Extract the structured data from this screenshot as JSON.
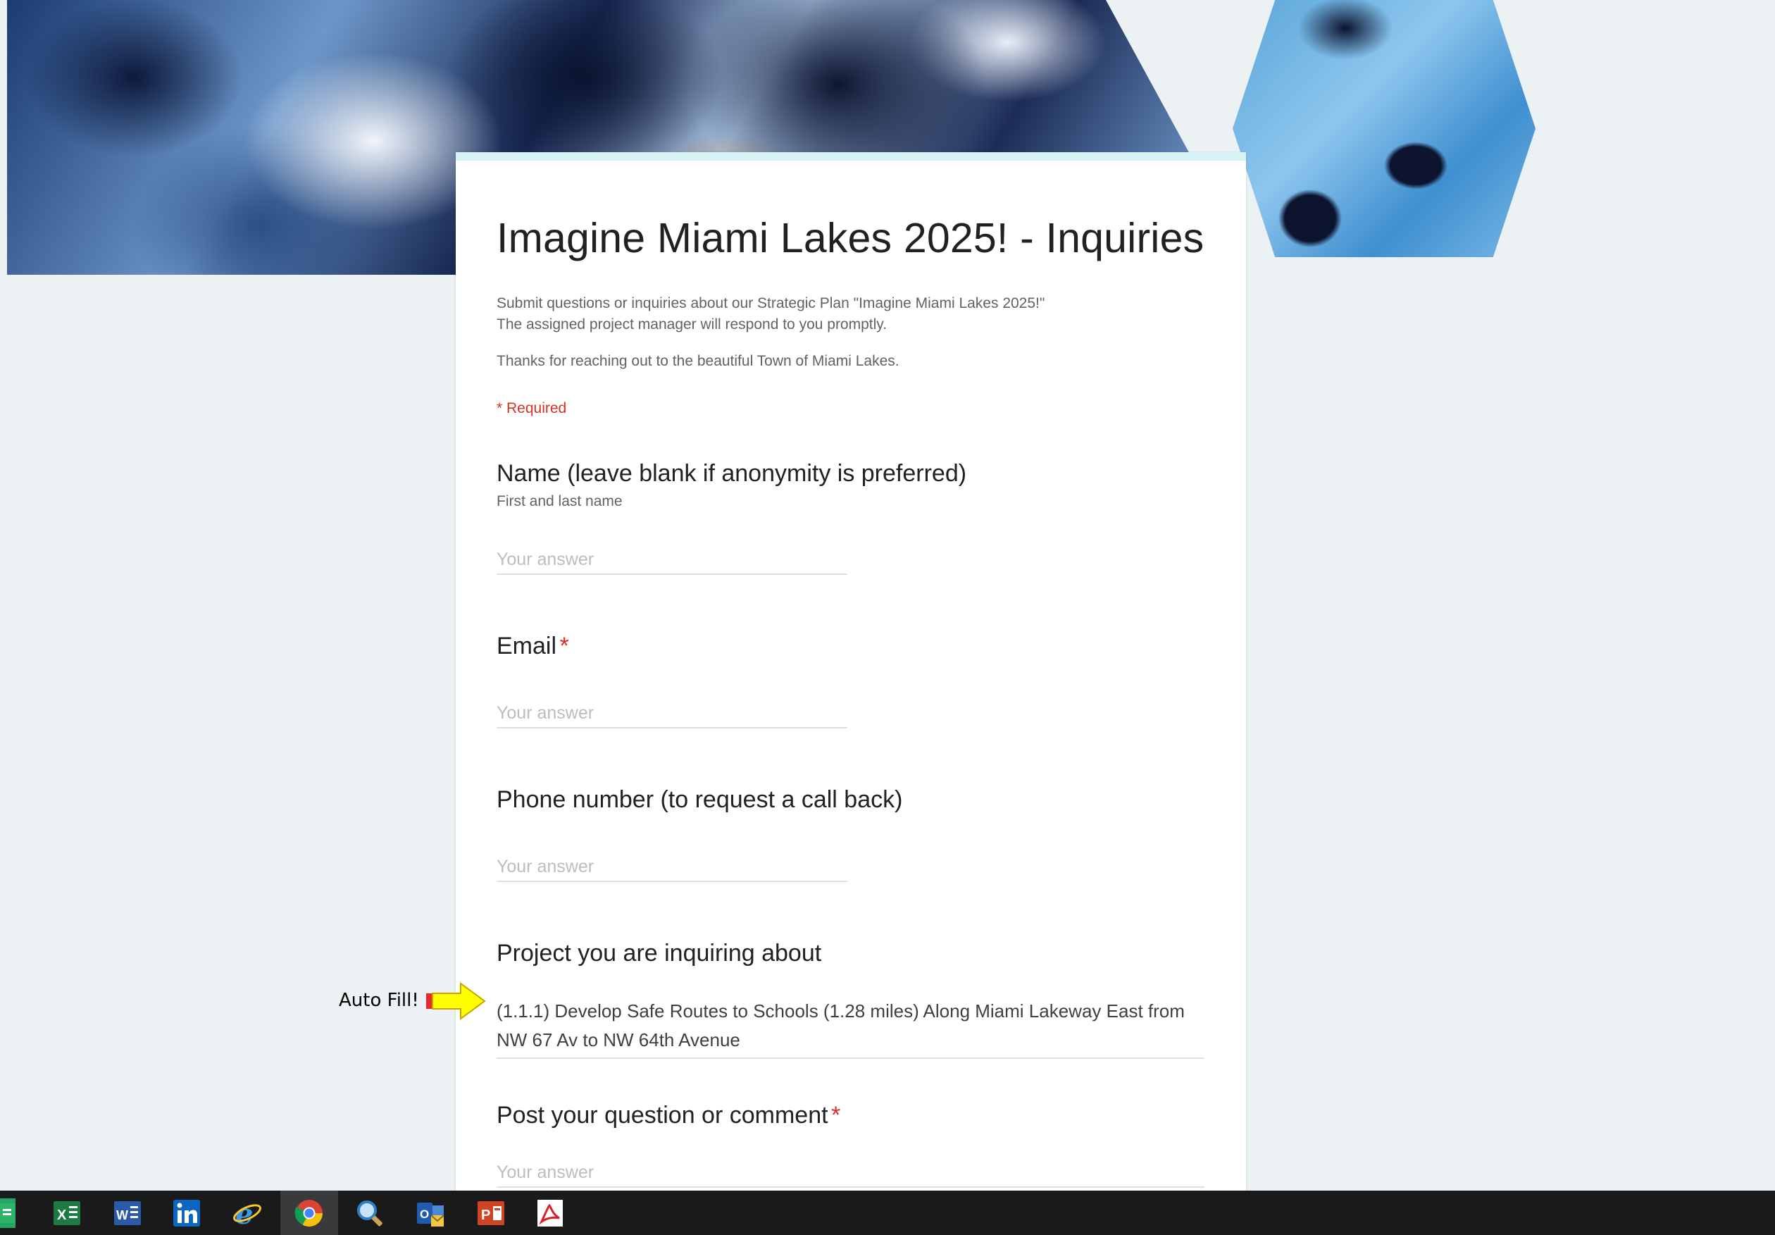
{
  "form": {
    "title": "Imagine Miami Lakes 2025! - Inquiries",
    "description_line1": "Submit questions or inquiries about our Strategic Plan \"Imagine Miami Lakes 2025!\"",
    "description_line2": "The assigned project manager will respond to you promptly.",
    "description_line3": "Thanks for reaching out to the beautiful Town of Miami Lakes.",
    "required_note": "* Required"
  },
  "questions": {
    "name": {
      "label": "Name (leave blank if anonymity is preferred)",
      "help": "First and last name",
      "placeholder": "Your answer",
      "value": ""
    },
    "email": {
      "label": "Email",
      "required_mark": "*",
      "placeholder": "Your answer",
      "value": ""
    },
    "phone": {
      "label": "Phone number (to request a call back)",
      "placeholder": "Your answer",
      "value": ""
    },
    "project": {
      "label": "Project you are inquiring about",
      "value": "(1.1.1) Develop Safe Routes to Schools (1.28 miles) Along Miami Lakeway East from NW 67 Av to NW 64th Avenue"
    },
    "comment": {
      "label": "Post your question or comment",
      "required_mark": "*",
      "placeholder": "Your answer",
      "value": ""
    }
  },
  "annotation": {
    "text": "Auto Fill!",
    "arrow_color": "#ffff00",
    "arrow_outline": "#e8282b"
  },
  "taskbar": {
    "icons": [
      "sheets-icon",
      "excel-icon",
      "word-icon",
      "linkedin-icon",
      "internet-explorer-icon",
      "chrome-icon",
      "search-magnifier-icon",
      "outlook-icon",
      "powerpoint-icon",
      "acrobat-icon"
    ],
    "active": "chrome-icon"
  },
  "colors": {
    "accent_bar": "#d6f2f4",
    "required": "#d93025",
    "page_background": "#ecf2f3"
  }
}
